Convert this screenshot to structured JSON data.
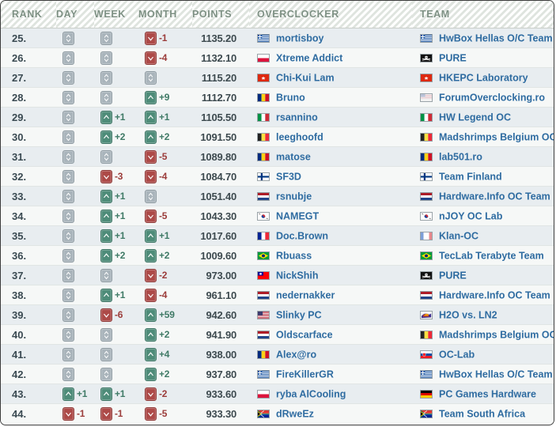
{
  "table": {
    "columns": [
      {
        "key": "rank",
        "label": "RANK"
      },
      {
        "key": "day",
        "label": "DAY"
      },
      {
        "key": "week",
        "label": "WEEK"
      },
      {
        "key": "month",
        "label": "MONTH"
      },
      {
        "key": "points",
        "label": "POINTS"
      },
      {
        "key": "overclocker",
        "label": "OVERCLOCKER"
      },
      {
        "key": "team",
        "label": "TEAM"
      }
    ],
    "colors": {
      "up": "#4e8c79",
      "down": "#ad4a48",
      "same": "#a9b4bb",
      "link": "#2f6ca1",
      "header_text": "#7d9083",
      "row_odd": "#e8edf0",
      "row_even": "#f6f8f7",
      "border": "#3c3c3c"
    },
    "rows": [
      {
        "rank": "25.",
        "day": {
          "dir": "same",
          "value": ""
        },
        "week": {
          "dir": "same",
          "value": ""
        },
        "month": {
          "dir": "down",
          "value": "-1"
        },
        "points": "1135.20",
        "overclocker": "mortisboy",
        "oc_flag": "greece",
        "team": "HwBox Hellas O/C Team",
        "team_flag": "greece"
      },
      {
        "rank": "26.",
        "day": {
          "dir": "same",
          "value": ""
        },
        "week": {
          "dir": "same",
          "value": ""
        },
        "month": {
          "dir": "down",
          "value": "-4"
        },
        "points": "1132.10",
        "overclocker": "Xtreme Addict",
        "oc_flag": "poland",
        "team": "PURE",
        "team_flag": "pirate"
      },
      {
        "rank": "27.",
        "day": {
          "dir": "same",
          "value": ""
        },
        "week": {
          "dir": "same",
          "value": ""
        },
        "month": {
          "dir": "same",
          "value": ""
        },
        "points": "1115.20",
        "overclocker": "Chi-Kui Lam",
        "oc_flag": "hongkong",
        "team": "HKEPC Laboratory",
        "team_flag": "hongkong"
      },
      {
        "rank": "28.",
        "day": {
          "dir": "same",
          "value": ""
        },
        "week": {
          "dir": "same",
          "value": ""
        },
        "month": {
          "dir": "up",
          "value": "+9"
        },
        "points": "1112.70",
        "overclocker": "Bruno",
        "oc_flag": "romania",
        "team": "ForumOverclocking.ro",
        "team_flag": "usa_faded"
      },
      {
        "rank": "29.",
        "day": {
          "dir": "same",
          "value": ""
        },
        "week": {
          "dir": "up",
          "value": "+1"
        },
        "month": {
          "dir": "up",
          "value": "+1"
        },
        "points": "1105.50",
        "overclocker": "rsannino",
        "oc_flag": "italy",
        "team": "HW Legend OC",
        "team_flag": "italy"
      },
      {
        "rank": "30.",
        "day": {
          "dir": "same",
          "value": ""
        },
        "week": {
          "dir": "up",
          "value": "+2"
        },
        "month": {
          "dir": "up",
          "value": "+2"
        },
        "points": "1091.50",
        "overclocker": "leeghoofd",
        "oc_flag": "belgium",
        "team": "Madshrimps Belgium OC Team",
        "team_flag": "belgium"
      },
      {
        "rank": "31.",
        "day": {
          "dir": "same",
          "value": ""
        },
        "week": {
          "dir": "same",
          "value": ""
        },
        "month": {
          "dir": "down",
          "value": "-5"
        },
        "points": "1089.80",
        "overclocker": "matose",
        "oc_flag": "romania",
        "team": "lab501.ro",
        "team_flag": "romania"
      },
      {
        "rank": "32.",
        "day": {
          "dir": "same",
          "value": ""
        },
        "week": {
          "dir": "down",
          "value": "-3"
        },
        "month": {
          "dir": "down",
          "value": "-4"
        },
        "points": "1084.70",
        "overclocker": "SF3D",
        "oc_flag": "finland",
        "team": "Team Finland",
        "team_flag": "finland"
      },
      {
        "rank": "33.",
        "day": {
          "dir": "same",
          "value": ""
        },
        "week": {
          "dir": "up",
          "value": "+1"
        },
        "month": {
          "dir": "same",
          "value": ""
        },
        "points": "1051.40",
        "overclocker": "rsnubje",
        "oc_flag": "netherlands",
        "team": "Hardware.Info OC Team",
        "team_flag": "netherlands"
      },
      {
        "rank": "34.",
        "day": {
          "dir": "same",
          "value": ""
        },
        "week": {
          "dir": "up",
          "value": "+1"
        },
        "month": {
          "dir": "down",
          "value": "-5"
        },
        "points": "1043.30",
        "overclocker": "NAMEGT",
        "oc_flag": "southkorea",
        "team": "nJOY OC Lab",
        "team_flag": "southkorea"
      },
      {
        "rank": "35.",
        "day": {
          "dir": "same",
          "value": ""
        },
        "week": {
          "dir": "up",
          "value": "+1"
        },
        "month": {
          "dir": "up",
          "value": "+1"
        },
        "points": "1017.60",
        "overclocker": "Doc.Brown",
        "oc_flag": "france",
        "team": "Klan-OC",
        "team_flag": "france_faded"
      },
      {
        "rank": "36.",
        "day": {
          "dir": "same",
          "value": ""
        },
        "week": {
          "dir": "up",
          "value": "+2"
        },
        "month": {
          "dir": "up",
          "value": "+2"
        },
        "points": "1009.60",
        "overclocker": "Rbuass",
        "oc_flag": "brazil",
        "team": "TecLab Terabyte Team",
        "team_flag": "brazil"
      },
      {
        "rank": "37.",
        "day": {
          "dir": "same",
          "value": ""
        },
        "week": {
          "dir": "same",
          "value": ""
        },
        "month": {
          "dir": "down",
          "value": "-2"
        },
        "points": "973.00",
        "overclocker": "NickShih",
        "oc_flag": "taiwan",
        "team": "PURE",
        "team_flag": "pirate"
      },
      {
        "rank": "38.",
        "day": {
          "dir": "same",
          "value": ""
        },
        "week": {
          "dir": "up",
          "value": "+1"
        },
        "month": {
          "dir": "down",
          "value": "-4"
        },
        "points": "961.10",
        "overclocker": "nedernakker",
        "oc_flag": "netherlands",
        "team": "Hardware.Info OC Team",
        "team_flag": "netherlands"
      },
      {
        "rank": "39.",
        "day": {
          "dir": "same",
          "value": ""
        },
        "week": {
          "dir": "down",
          "value": "-6"
        },
        "month": {
          "dir": "up",
          "value": "+59"
        },
        "points": "942.60",
        "overclocker": "Slinky PC",
        "oc_flag": "usa",
        "team": "H2O vs. LN2",
        "team_flag": "custom_h2o"
      },
      {
        "rank": "40.",
        "day": {
          "dir": "same",
          "value": ""
        },
        "week": {
          "dir": "same",
          "value": ""
        },
        "month": {
          "dir": "up",
          "value": "+2"
        },
        "points": "941.90",
        "overclocker": "Oldscarface",
        "oc_flag": "netherlands",
        "team": "Madshrimps Belgium OC Team",
        "team_flag": "belgium"
      },
      {
        "rank": "41.",
        "day": {
          "dir": "same",
          "value": ""
        },
        "week": {
          "dir": "same",
          "value": ""
        },
        "month": {
          "dir": "up",
          "value": "+4"
        },
        "points": "938.00",
        "overclocker": "Alex@ro",
        "oc_flag": "romania",
        "team": "OC-Lab",
        "team_flag": "slovakia"
      },
      {
        "rank": "42.",
        "day": {
          "dir": "same",
          "value": ""
        },
        "week": {
          "dir": "same",
          "value": ""
        },
        "month": {
          "dir": "up",
          "value": "+2"
        },
        "points": "937.80",
        "overclocker": "FireKillerGR",
        "oc_flag": "greece",
        "team": "HwBox Hellas O/C Team",
        "team_flag": "greece"
      },
      {
        "rank": "43.",
        "day": {
          "dir": "up",
          "value": "+1"
        },
        "week": {
          "dir": "up",
          "value": "+1"
        },
        "month": {
          "dir": "down",
          "value": "-2"
        },
        "points": "933.60",
        "overclocker": "ryba AlCooling",
        "oc_flag": "poland",
        "team": "PC Games Hardware",
        "team_flag": "germany"
      },
      {
        "rank": "44.",
        "day": {
          "dir": "down",
          "value": "-1"
        },
        "week": {
          "dir": "down",
          "value": "-1"
        },
        "month": {
          "dir": "down",
          "value": "-5"
        },
        "points": "933.30",
        "overclocker": "dRweEz",
        "oc_flag": "southafrica",
        "team": "Team South Africa",
        "team_flag": "southafrica"
      }
    ]
  }
}
